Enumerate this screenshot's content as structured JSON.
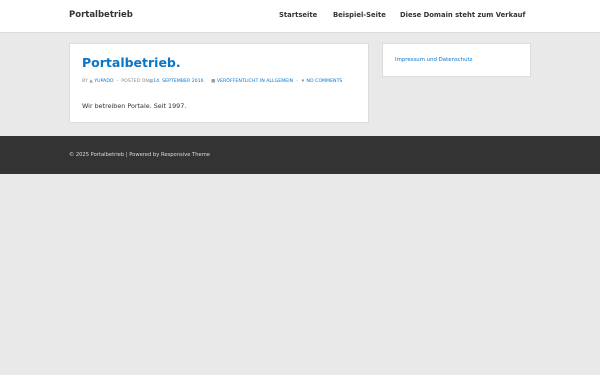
{
  "header": {
    "site_title": "Portalbetrieb",
    "nav": [
      "Startseite",
      "Beispiel-Seite",
      "Diese Domain steht zum Verkauf"
    ]
  },
  "post": {
    "title": "Portalbetrieb.",
    "meta": {
      "by": "BY",
      "author": "YUPADO",
      "sep1": "-",
      "posted_on": "POSTED ON",
      "date": "14. SEPTEMBER 2016",
      "category": "VERÖFFENTLICHT IN ALLGEMEIN",
      "sep2": "-",
      "comments": "NO COMMENTS"
    },
    "content": "Wir betreiben Portale. Seit 1997."
  },
  "sidebar": {
    "links": [
      "Impressum und Datenschutz"
    ]
  },
  "footer": {
    "copyright": "© 2025 Portalbetrieb",
    "separator": "|",
    "powered_by": "Powered by",
    "theme_link": "Responsive Theme"
  },
  "colors": {
    "link": "#0a76c8",
    "page_bg": "#e9e9e9",
    "footer_bg": "#333333"
  }
}
